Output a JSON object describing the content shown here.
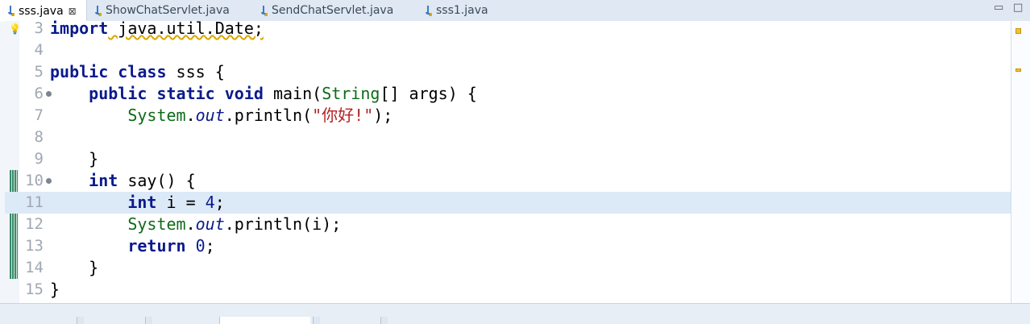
{
  "tabs": [
    {
      "label": "sss.java",
      "active": true,
      "close_glyph": "⊠"
    },
    {
      "label": "ShowChatServlet.java",
      "active": false
    },
    {
      "label": "SendChatServlet.java",
      "active": false
    },
    {
      "label": "sss1.java",
      "active": false
    }
  ],
  "window_controls": {
    "minimize": "▭",
    "maximize": "□"
  },
  "editor": {
    "highlighted_line": "11",
    "lines": [
      {
        "n": "3",
        "tokens": [
          "import",
          " java.util.Date;"
        ]
      },
      {
        "n": "4",
        "tokens": []
      },
      {
        "n": "5",
        "tokens": [
          "public",
          " ",
          "class",
          " sss {"
        ]
      },
      {
        "n": "6",
        "tokens": [
          "    ",
          "public",
          " ",
          "static",
          " ",
          "void",
          " main(",
          "String",
          "[] args) {"
        ]
      },
      {
        "n": "7",
        "tokens": [
          "        ",
          "System",
          ".",
          "out",
          ".println(",
          "\"你好!\"",
          ");"
        ]
      },
      {
        "n": "8",
        "tokens": []
      },
      {
        "n": "9",
        "tokens": [
          "    }"
        ]
      },
      {
        "n": "10",
        "tokens": [
          "    ",
          "int",
          " say() {"
        ]
      },
      {
        "n": "11",
        "tokens": [
          "        ",
          "int",
          " i = ",
          "4",
          ";"
        ]
      },
      {
        "n": "12",
        "tokens": [
          "        ",
          "System",
          ".",
          "out",
          ".println(i);"
        ]
      },
      {
        "n": "13",
        "tokens": [
          "        ",
          "return",
          " ",
          "0",
          ";"
        ]
      },
      {
        "n": "14",
        "tokens": [
          "    }"
        ]
      },
      {
        "n": "15",
        "tokens": [
          "}"
        ]
      }
    ]
  },
  "icons": {
    "tab_file": "java-file-icon",
    "warning": "lightbulb-warning-icon",
    "fold": "fold-collapse-icon",
    "overview_marker": "warning-marker-icon"
  },
  "colors": {
    "keyword": "#0a1a8c",
    "type": "#0d6b19",
    "string": "#b22222",
    "highlight": "#dce9f7"
  }
}
